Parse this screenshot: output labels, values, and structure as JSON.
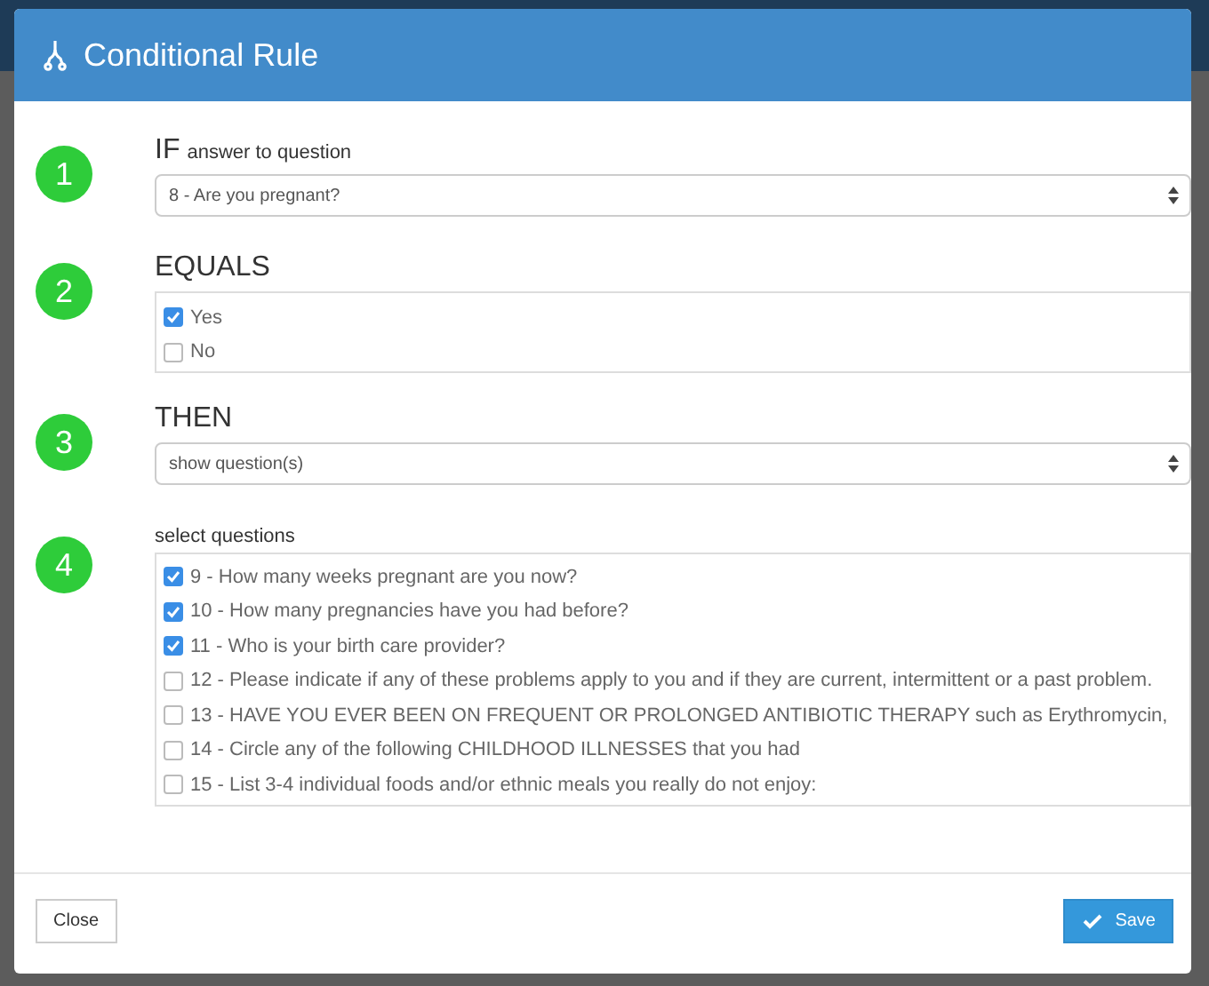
{
  "modal": {
    "title": "Conditional Rule",
    "steps": [
      {
        "number": "1",
        "kind": "select",
        "heading": "IF",
        "subheading": "answer to question",
        "value": "8 - Are you pregnant?"
      },
      {
        "number": "2",
        "kind": "options",
        "heading": "EQUALS",
        "options": [
          {
            "label": "Yes",
            "checked": true
          },
          {
            "label": "No",
            "checked": false
          }
        ]
      },
      {
        "number": "3",
        "kind": "select",
        "heading": "THEN",
        "value": "show question(s)"
      },
      {
        "number": "4",
        "kind": "options",
        "label": "select questions",
        "options": [
          {
            "label": "9 - How many weeks pregnant are you now?",
            "checked": true
          },
          {
            "label": "10 - How many pregnancies have you had before?",
            "checked": true
          },
          {
            "label": "11 - Who is your birth care provider?",
            "checked": true
          },
          {
            "label": "12 - Please indicate if any of these problems apply to you and if they are current, intermittent or a past problem.",
            "checked": false
          },
          {
            "label": "13 - HAVE YOU EVER BEEN ON FREQUENT OR PROLONGED ANTIBIOTIC THERAPY such as Erythromycin,",
            "checked": false
          },
          {
            "label": "14 - Circle any of the following CHILDHOOD ILLNESSES that you had",
            "checked": false
          },
          {
            "label": "15 - List 3-4 individual foods and/or ethnic meals you really do not enjoy:",
            "checked": false
          }
        ]
      }
    ],
    "close_button": "Close",
    "save_button": "Save"
  }
}
